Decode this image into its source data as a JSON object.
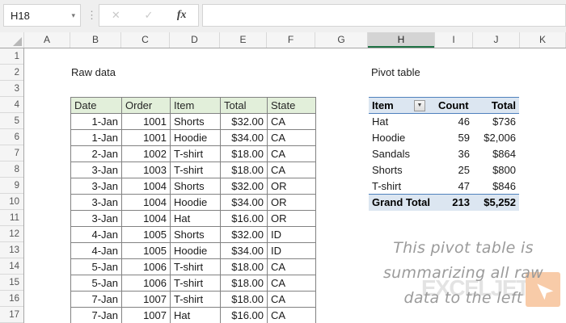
{
  "name_box": {
    "value": "H18"
  },
  "formula_bar": {
    "cancel_label": "✕",
    "confirm_label": "✓",
    "fx_label": "fx",
    "value": ""
  },
  "sheet": {
    "column_headers": [
      "A",
      "B",
      "C",
      "D",
      "E",
      "F",
      "G",
      "H",
      "I",
      "J",
      "K"
    ],
    "selected_column": "H",
    "row_headers": [
      "1",
      "2",
      "3",
      "4",
      "5",
      "6",
      "7",
      "8",
      "9",
      "10",
      "11",
      "12",
      "13",
      "14",
      "15",
      "16",
      "17"
    ]
  },
  "raw_data": {
    "title": "Raw data",
    "headers": [
      "Date",
      "Order",
      "Item",
      "Total",
      "State"
    ],
    "rows": [
      [
        "1-Jan",
        "1001",
        "Shorts",
        "$32.00",
        "CA"
      ],
      [
        "1-Jan",
        "1001",
        "Hoodie",
        "$34.00",
        "CA"
      ],
      [
        "2-Jan",
        "1002",
        "T-shirt",
        "$18.00",
        "CA"
      ],
      [
        "3-Jan",
        "1003",
        "T-shirt",
        "$18.00",
        "CA"
      ],
      [
        "3-Jan",
        "1004",
        "Shorts",
        "$32.00",
        "OR"
      ],
      [
        "3-Jan",
        "1004",
        "Hoodie",
        "$34.00",
        "OR"
      ],
      [
        "3-Jan",
        "1004",
        "Hat",
        "$16.00",
        "OR"
      ],
      [
        "4-Jan",
        "1005",
        "Shorts",
        "$32.00",
        "ID"
      ],
      [
        "4-Jan",
        "1005",
        "Hoodie",
        "$34.00",
        "ID"
      ],
      [
        "5-Jan",
        "1006",
        "T-shirt",
        "$18.00",
        "CA"
      ],
      [
        "5-Jan",
        "1006",
        "T-shirt",
        "$18.00",
        "CA"
      ],
      [
        "7-Jan",
        "1007",
        "T-shirt",
        "$18.00",
        "CA"
      ],
      [
        "7-Jan",
        "1007",
        "Hat",
        "$16.00",
        "CA"
      ]
    ]
  },
  "pivot_table": {
    "title": "Pivot table",
    "headers": [
      "Item",
      "Count",
      "Total"
    ],
    "filter_icon": "▼",
    "rows": [
      [
        "Hat",
        "46",
        "$736"
      ],
      [
        "Hoodie",
        "59",
        "$2,006"
      ],
      [
        "Sandals",
        "36",
        "$864"
      ],
      [
        "Shorts",
        "25",
        "$800"
      ],
      [
        "T-shirt",
        "47",
        "$846"
      ]
    ],
    "grand_total": [
      "Grand Total",
      "213",
      "$5,252"
    ]
  },
  "annotation": {
    "lines": [
      "This pivot table is",
      "summarizing all raw",
      "data to the left"
    ]
  },
  "watermark": {
    "text": "EXCELJET",
    "logo": "paper-plane"
  },
  "colors": {
    "raw_header_fill": "#E2EFDA",
    "pivot_fill": "#DCE6F1",
    "pivot_border": "#4F81BD",
    "selected_column_underline": "#217346",
    "logo_orange": "#F8CBA8",
    "annotation_gray": "#9B9B9B"
  }
}
